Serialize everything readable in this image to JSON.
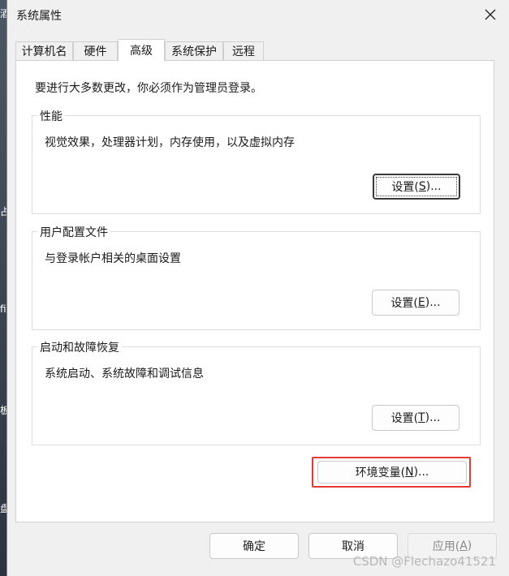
{
  "window": {
    "title": "系统属性"
  },
  "tabs": [
    {
      "label": "计算机名",
      "active": false
    },
    {
      "label": "硬件",
      "active": false
    },
    {
      "label": "高级",
      "active": true
    },
    {
      "label": "系统保护",
      "active": false
    },
    {
      "label": "远程",
      "active": false
    }
  ],
  "notice": "要进行大多数更改，你必须作为管理员登录。",
  "groups": {
    "performance": {
      "title": "性能",
      "description": "视觉效果，处理器计划，内存使用，以及虚拟内存",
      "button": {
        "prefix": "设置(",
        "mnemonic": "S",
        "suffix": ")..."
      }
    },
    "profiles": {
      "title": "用户配置文件",
      "description": "与登录帐户相关的桌面设置",
      "button": {
        "prefix": "设置(",
        "mnemonic": "E",
        "suffix": ")..."
      }
    },
    "startup": {
      "title": "启动和故障恢复",
      "description": "系统启动、系统故障和调试信息",
      "button": {
        "prefix": "设置(",
        "mnemonic": "T",
        "suffix": ")..."
      }
    }
  },
  "env_button": {
    "prefix": "环境变量(",
    "mnemonic": "N",
    "suffix": ")..."
  },
  "footer": {
    "ok": "确定",
    "cancel": "取消",
    "apply": {
      "prefix": "应用(",
      "mnemonic": "A",
      "suffix": ")",
      "disabled": true
    }
  },
  "watermark": "CSDN @Flechazo41521",
  "desktop_fragments": [
    "酒",
    "占",
    "fic",
    "板",
    "盘"
  ],
  "colors": {
    "highlight": "#e53935",
    "window_bg": "#f0f0f0",
    "panel_bg": "#ffffff"
  }
}
